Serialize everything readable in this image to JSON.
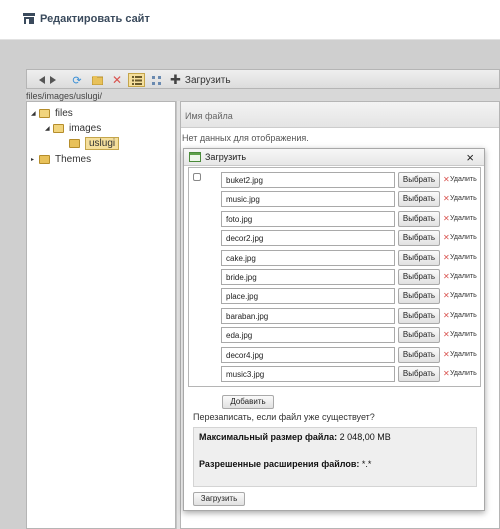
{
  "header": {
    "title": "Редактировать сайт",
    "icon": "store-icon"
  },
  "toolbar": {
    "upload_label": "Загрузить",
    "buttons": [
      "back-icon",
      "forward-icon",
      "refresh-icon",
      "new-folder-icon",
      "delete-icon",
      "list-view-icon",
      "thumbnail-view-icon",
      "plus-icon"
    ]
  },
  "path": "files/images/uslugi/",
  "tree": {
    "items": [
      {
        "label": "files",
        "expanded": true
      },
      {
        "label": "images",
        "expanded": true
      },
      {
        "label": "uslugi",
        "selected": true
      },
      {
        "label": "Themes",
        "expanded": false
      }
    ]
  },
  "grid": {
    "column_header": "Имя файла",
    "empty_text": "Нет данных для отображения."
  },
  "dialog": {
    "title": "Загрузить",
    "browse_label": "Выбрать",
    "remove_label": "Удалить",
    "files": [
      "buket2.jpg",
      "music.jpg",
      "foto.jpg",
      "decor2.jpg",
      "cake.jpg",
      "bride.jpg",
      "place.jpg",
      "baraban.jpg",
      "eda.jpg",
      "decor4.jpg",
      "music3.jpg"
    ],
    "add_label": "Добавить",
    "overwrite_label": "Перезаписать, если файл уже существует?",
    "max_size_label": "Максимальный размер файла:",
    "max_size_value": "2 048,00 MB",
    "extensions_label": "Разрешенные расширения файлов:",
    "extensions_value": "*.*",
    "submit_label": "Загрузить"
  },
  "colors": {
    "selection": "#f5df9c",
    "folder": "#e8c15a",
    "delete": "#d9534f",
    "refresh": "#3a8fd6"
  }
}
